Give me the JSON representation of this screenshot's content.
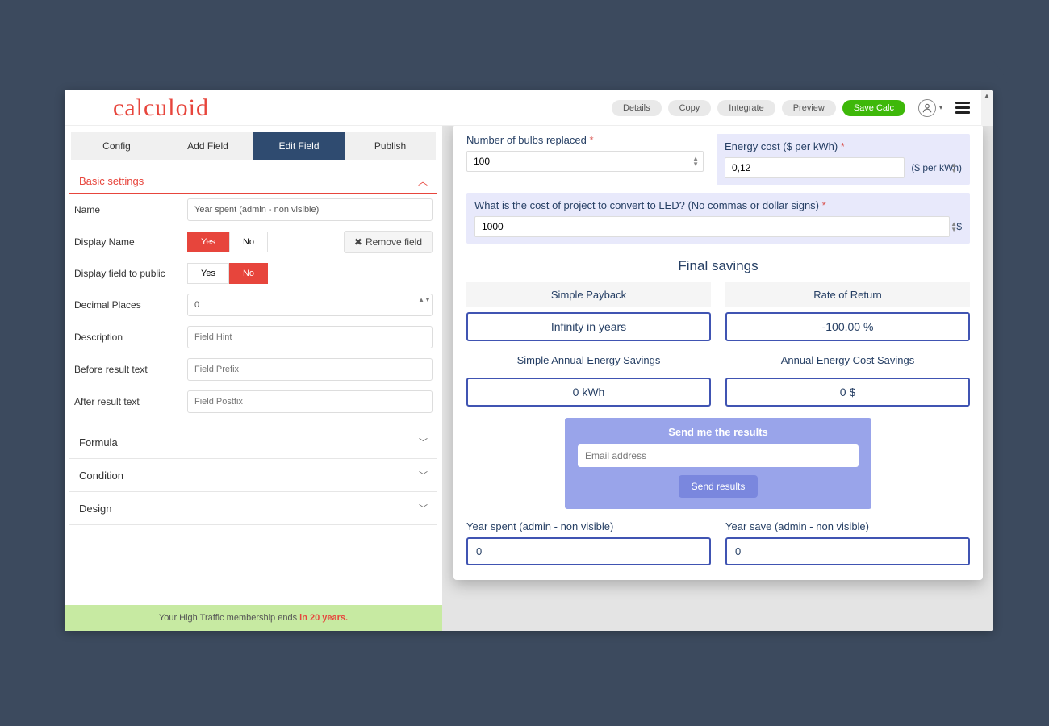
{
  "logo_text": "calculoid",
  "top_buttons": {
    "details": "Details",
    "copy": "Copy",
    "integrate": "Integrate",
    "preview": "Preview",
    "save": "Save Calc"
  },
  "tabs": {
    "config": "Config",
    "add": "Add Field",
    "edit": "Edit Field",
    "publish": "Publish"
  },
  "panel": {
    "basic_settings": "Basic settings",
    "name_label": "Name",
    "name_value": "Year spent (admin - non visible)",
    "display_name_label": "Display Name",
    "yes": "Yes",
    "no": "No",
    "remove_field": "Remove field",
    "display_public_label": "Display field to public",
    "decimal_label": "Decimal Places",
    "decimal_value": "0",
    "description_label": "Description",
    "description_placeholder": "Field Hint",
    "before_label": "Before result text",
    "before_placeholder": "Field Prefix",
    "after_label": "After result text",
    "after_placeholder": "Field Postfix",
    "acc_formula": "Formula",
    "acc_condition": "Condition",
    "acc_design": "Design"
  },
  "membership": {
    "prefix": "Your High Traffic membership ends ",
    "bold": "in 20 years."
  },
  "preview": {
    "bulbs_label": "Number of bulbs replaced",
    "bulbs_value": "100",
    "energy_label": "Energy cost ($ per kWh)",
    "energy_value": "0,12",
    "energy_unit": "($ per kWh)",
    "cost_label": "What is the cost of project to convert to LED? (No commas or dollar signs)",
    "cost_value": "1000",
    "cost_unit": "$",
    "heading": "Final savings",
    "payback_label": "Simple Payback",
    "payback_value": "Infinity in years",
    "ror_label": "Rate of Return",
    "ror_value": "-100.00 %",
    "annual_energy_label": "Simple Annual Energy Savings",
    "annual_energy_value": "0 kWh",
    "annual_cost_label": "Annual Energy Cost Savings",
    "annual_cost_value": "0 $",
    "send_title": "Send me the results",
    "email_placeholder": "Email address",
    "send_button": "Send results",
    "year_spent_label": "Year spent (admin - non visible)",
    "year_spent_value": "0",
    "year_save_label": "Year save (admin - non visible)",
    "year_save_value": "0"
  }
}
